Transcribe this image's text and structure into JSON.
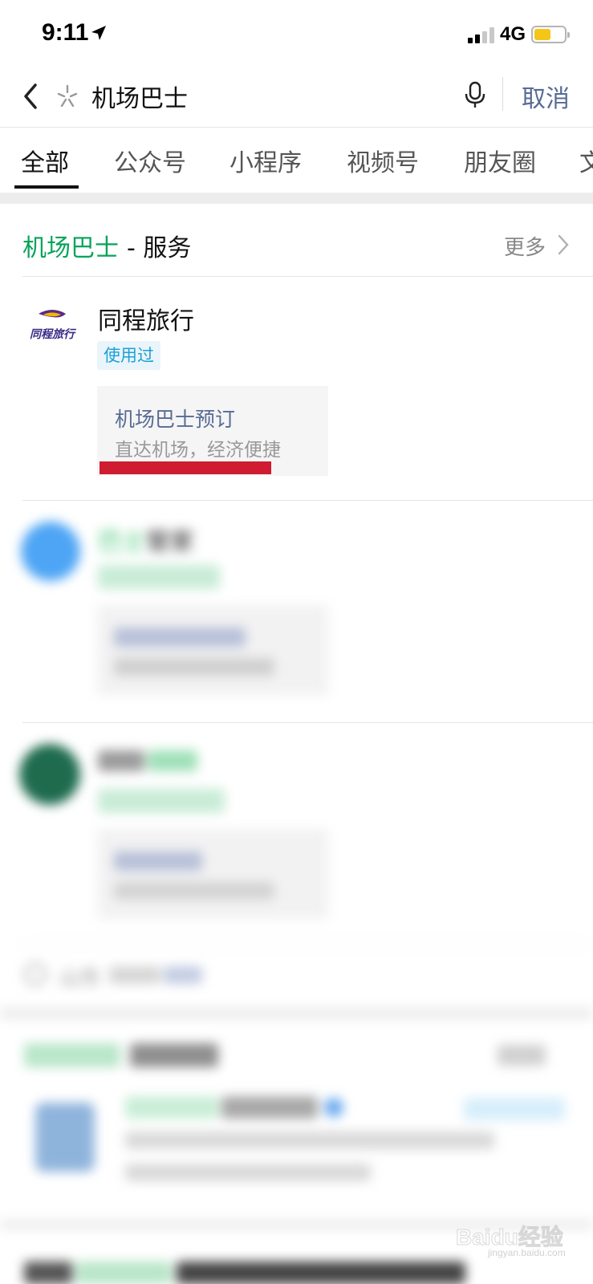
{
  "status_bar": {
    "time": "9:11",
    "network": "4G",
    "battery_level": 0.55,
    "battery_color": "#f5c518"
  },
  "search": {
    "query": "机场巴士",
    "cancel_label": "取消",
    "back_icon": "chevron-left-icon",
    "mic_icon": "microphone-icon"
  },
  "tabs": [
    {
      "label": "全部",
      "active": true
    },
    {
      "label": "公众号",
      "active": false
    },
    {
      "label": "小程序",
      "active": false
    },
    {
      "label": "视频号",
      "active": false
    },
    {
      "label": "朋友圈",
      "active": false
    },
    {
      "label": "文",
      "active": false
    }
  ],
  "service_section": {
    "keyword": "机场巴士",
    "title_rest": "- 服务",
    "more_label": "更多",
    "keyword_color": "#07a35a"
  },
  "service_results": [
    {
      "provider": "同程旅行",
      "logo_text": "同程旅行",
      "badge": "使用过",
      "card_title": "机场巴士预订",
      "card_subtitle": "直达机场，经济便捷"
    },
    {
      "provider_prefix": "巴士",
      "provider_suffix": "管家"
    }
  ],
  "location_row": {
    "text": "山东"
  },
  "watermark": {
    "brand": "Baidu经验",
    "site": "jingyan.baidu.com"
  }
}
